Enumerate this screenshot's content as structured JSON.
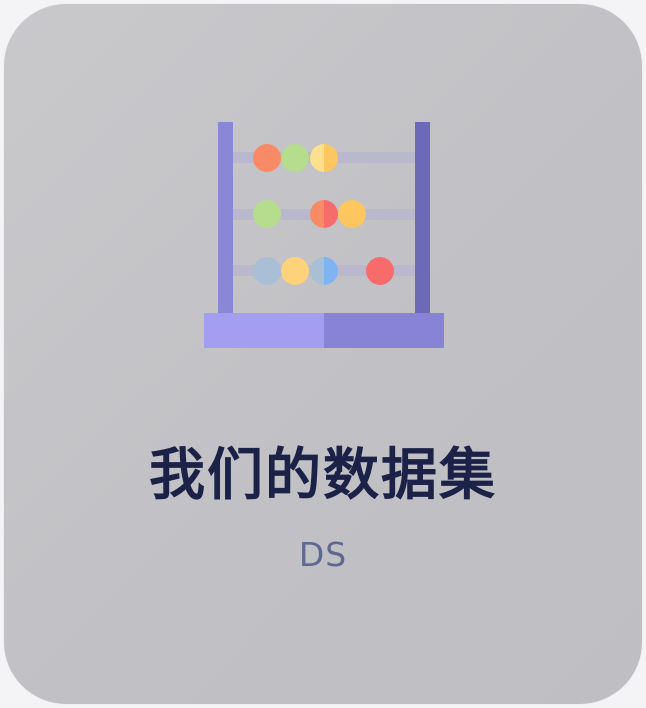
{
  "card": {
    "title": "我们的数据集",
    "subtitle": "DS"
  },
  "icon": {
    "name": "abacus-icon",
    "colors": {
      "frame_light": "#8a87d6",
      "frame_dark": "#6b69b8",
      "base_light": "#a39ef0",
      "base_dark": "#8784d6",
      "rod": "#b8b8cc",
      "orange": "#f98a66",
      "green": "#b6dc8e",
      "yellow": "#fdd27a",
      "red": "#f76b6b",
      "blue": "#7eb4f2",
      "grey_blue": "#a9bfd6"
    }
  }
}
